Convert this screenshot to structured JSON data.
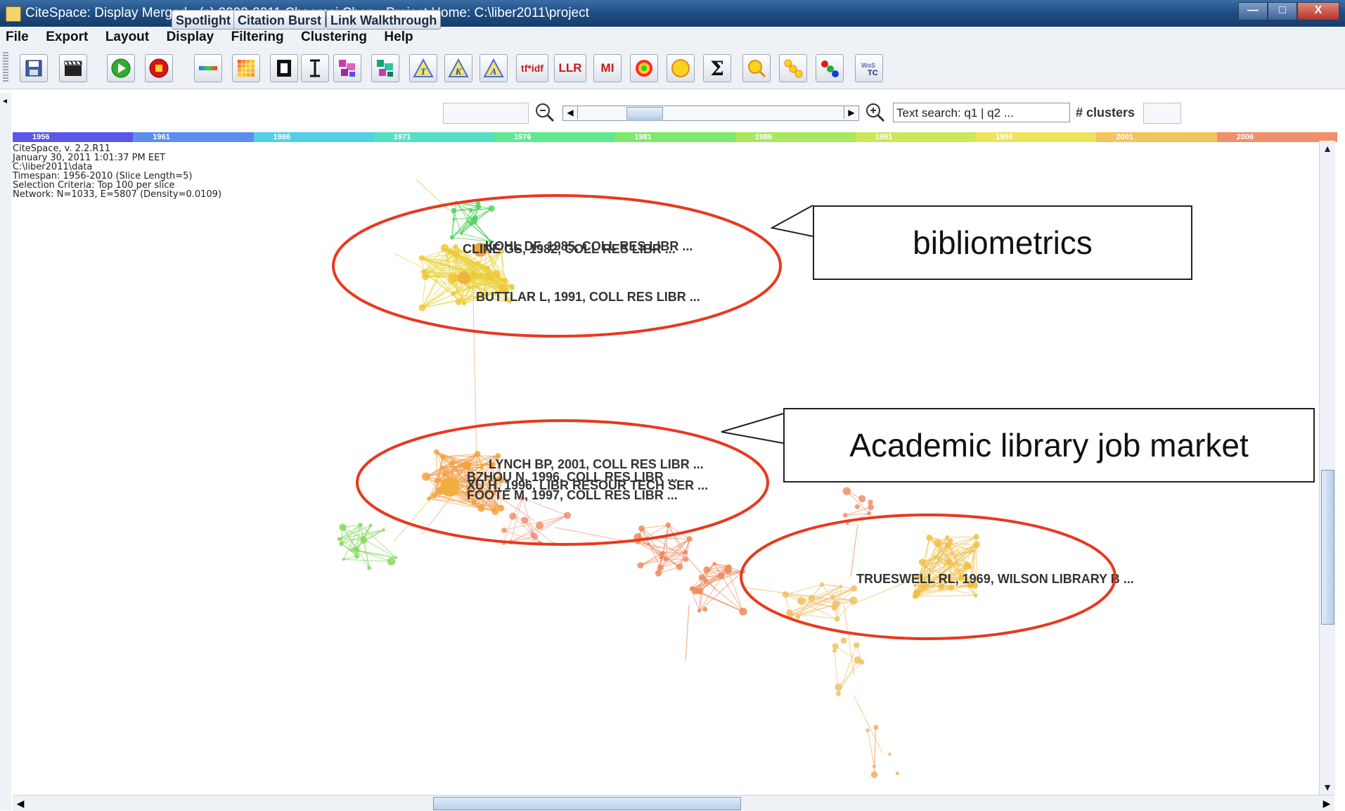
{
  "window": {
    "title": "CiteSpace: Display Merged - (c) 2003-2011 Chaomei Chen - Project Home: C:\\liber2011\\project",
    "minimize": "—",
    "maximize": "□",
    "close": "X"
  },
  "menu": [
    "File",
    "Export",
    "Layout",
    "Display",
    "Filtering",
    "Clustering",
    "Help"
  ],
  "toolbar": {
    "buttons": [
      {
        "name": "save-icon"
      },
      {
        "name": "clapper-icon"
      },
      {
        "name": "play-icon"
      },
      {
        "name": "stop-icon"
      },
      {
        "name": "gradient-line-icon"
      },
      {
        "name": "color-grid-icon"
      },
      {
        "name": "bracket-icon"
      },
      {
        "name": "text-cursor-icon"
      },
      {
        "name": "cluster-pink-icon"
      },
      {
        "name": "cluster-teal-icon"
      },
      {
        "name": "triangle-t-icon"
      },
      {
        "name": "triangle-k-icon"
      },
      {
        "name": "triangle-a-icon"
      },
      {
        "name": "tfidf-button",
        "label": "tf*idf"
      },
      {
        "name": "llr-button",
        "label": "LLR"
      },
      {
        "name": "mi-button",
        "label": "MI"
      },
      {
        "name": "target-icon"
      },
      {
        "name": "yellow-circle-icon"
      },
      {
        "name": "sigma-button",
        "label": "Σ"
      },
      {
        "name": "magnify-yellow-icon"
      },
      {
        "name": "yellow-chain-icon"
      },
      {
        "name": "red-blue-dots-icon"
      },
      {
        "name": "wos-tc-button",
        "label": "WoS TC"
      }
    ]
  },
  "controls": {
    "spotlight": "Spotlight",
    "citation_burst": "Citation Burst",
    "link_walkthrough": "Link Walkthrough",
    "search_placeholder": "Text search: q1 | q2 ...",
    "clusters_label": "# clusters"
  },
  "timeline": {
    "years": [
      "1956",
      "1961",
      "1966",
      "1971",
      "1976",
      "1981",
      "1986",
      "1991",
      "1996",
      "2001",
      "2006"
    ],
    "colors": [
      "#5a56e8",
      "#5c8ef0",
      "#55cfe8",
      "#55e0c6",
      "#5ee890",
      "#7ee86a",
      "#a8e85e",
      "#cbe85a",
      "#ece55c",
      "#f3c45e",
      "#f0906a"
    ]
  },
  "info": [
    "CiteSpace, v. 2.2.R11",
    "January 30, 2011 1:01:37 PM EET",
    "C:\\liber2011\\data",
    "Timespan: 1956-2010 (Slice Length=5)",
    "Selection Criteria: Top 100 per slice",
    "Network: N=1033, E=5807 (Density=0.0109)"
  ],
  "nodes": {
    "cline": "CLINE GS, 1982, COLL RES LIBR ...",
    "coul": "KOHL DF, 1985, COLL RES LIBR ...",
    "buttlar": "BUTTLAR L, 1991, COLL RES LIBR ...",
    "lynch": "LYNCH BP, 2001, COLL RES LIBR ...",
    "bzhou": "BZHOU N, 1996, COLL RES LIBR ...",
    "xu": "XU H, 1996, LIBR RESOUR TECH SER ...",
    "foote": "FOOTE M, 1997, COLL RES LIBR ...",
    "trueswell": "TRUESWELL RL, 1969, WILSON LIBRARY B ..."
  },
  "annotations": {
    "bibliometrics": "bibliometrics",
    "job_market": "Academic library job market"
  },
  "colors": {
    "highlight_ellipse": "#e8391e",
    "early_cluster": "#58c94a",
    "mid_cluster": "#e8d23a",
    "late_cluster": "#f08a5a"
  }
}
